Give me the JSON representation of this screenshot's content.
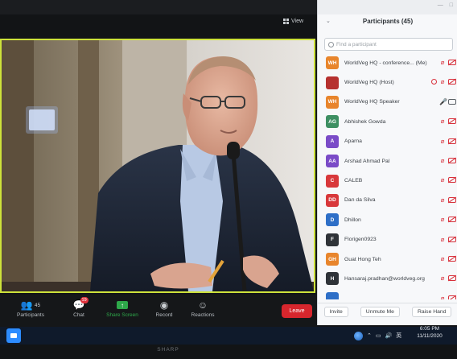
{
  "view": {
    "label": "View"
  },
  "toolbar": {
    "participants_label": "Participants",
    "participants_count": "45",
    "chat_label": "Chat",
    "chat_badge": "19",
    "share_label": "Share Screen",
    "record_label": "Record",
    "reactions_label": "Reactions",
    "leave_label": "Leave"
  },
  "panel": {
    "title": "Participants (45)",
    "search_placeholder": "Find a participant",
    "participants": [
      {
        "initials": "WH",
        "name": "WorldVeg HQ - conference... (Me)",
        "color": "#e8852c"
      },
      {
        "initials": "",
        "name": "WorldVeg HQ (Host)",
        "color": "#b6312f"
      },
      {
        "initials": "WH",
        "name": "WorldVeg HQ Speaker",
        "color": "#e8852c"
      },
      {
        "initials": "AG",
        "name": "Abhishek Gowda",
        "color": "#3e8f62"
      },
      {
        "initials": "A",
        "name": "Aparna",
        "color": "#7a4bc7"
      },
      {
        "initials": "AA",
        "name": "Arshad Ahmad Pal",
        "color": "#7a4bc7"
      },
      {
        "initials": "C",
        "name": "CALEB",
        "color": "#d8383b"
      },
      {
        "initials": "DD",
        "name": "Dan da Silva",
        "color": "#d8383b"
      },
      {
        "initials": "D",
        "name": "Dhillon",
        "color": "#2e6fc7"
      },
      {
        "initials": "F",
        "name": "Florigen0923",
        "color": "#2f3338"
      },
      {
        "initials": "GH",
        "name": "Guat Hong Teh",
        "color": "#e8852c"
      },
      {
        "initials": "H",
        "name": "Hansaraj.pradhan@worldveg.org",
        "color": "#2f3338"
      },
      {
        "initials": "",
        "name": "",
        "color": "#2e6fc7"
      }
    ],
    "invite_label": "Invite",
    "unmute_label": "Unmute Me",
    "raise_label": "Raise Hand"
  },
  "taskbar": {
    "time": "6:05 PM",
    "date": "11/11/2020"
  },
  "monitor": {
    "brand": "SHARP"
  }
}
